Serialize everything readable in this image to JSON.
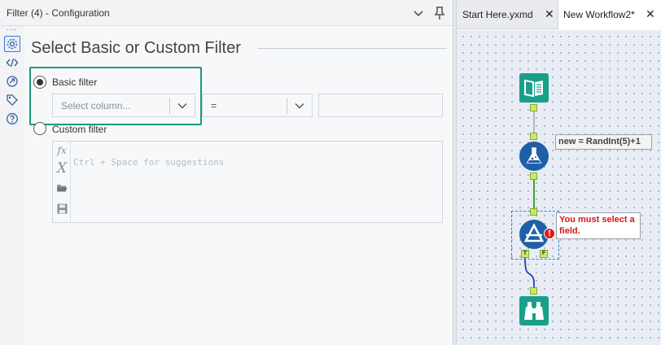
{
  "panel": {
    "title": "Filter (4) - Configuration",
    "rail_dots": "···",
    "section_title": "Select Basic or Custom Filter",
    "basic_filter": {
      "label": "Basic filter",
      "checked": true,
      "column_placeholder": "Select column...",
      "operator_value": "=",
      "value": ""
    },
    "custom_filter": {
      "label": "Custom filter",
      "checked": false,
      "editor_placeholder": "Ctrl + Space for suggestions",
      "toolbar_icons": [
        "fx-icon",
        "variable-x-icon",
        "folder-open-icon",
        "save-icon"
      ]
    }
  },
  "canvas": {
    "tabs": [
      {
        "label": "Start Here.yxmd",
        "active": false,
        "close": "✕"
      },
      {
        "label": "New Workflow2*",
        "active": true,
        "close": "✕"
      }
    ],
    "tools": [
      {
        "name": "input-data-tool",
        "icon": "book-icon",
        "color": "#1aa08a"
      },
      {
        "name": "formula-tool",
        "icon": "flask-icon",
        "color": "#1f5fa8"
      },
      {
        "name": "filter-tool",
        "icon": "filter-triangle-icon",
        "color": "#1f5fa8"
      },
      {
        "name": "browse-tool",
        "icon": "binoculars-icon",
        "color": "#1aa08a"
      }
    ],
    "formula_annotation": "new = RandInt(5)+1",
    "error_annotation": "You must select a field.",
    "filter_true_anchor": "T",
    "filter_false_anchor": "F",
    "error_badge": "!"
  },
  "colors": {
    "highlight": "#1a9b7a",
    "error": "#d11a1a",
    "selection": "#2d7fd1",
    "connection_green": "#3aa63a",
    "connection_blue": "#1f3fbf"
  }
}
